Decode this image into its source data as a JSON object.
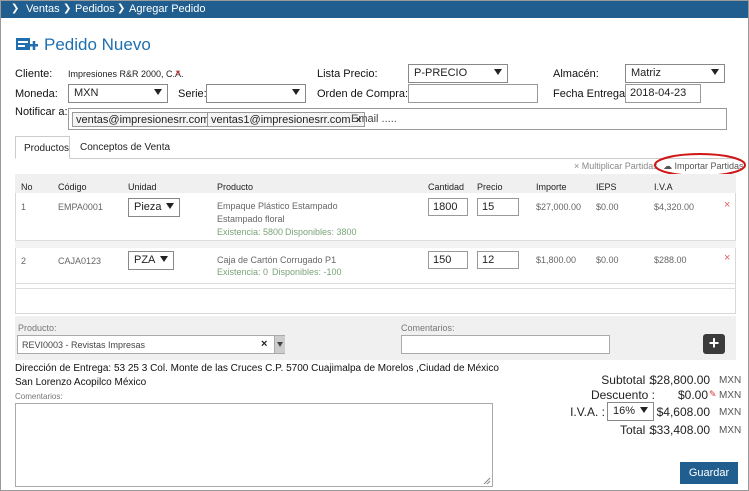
{
  "breadcrumb": [
    "Ventas",
    "Pedidos",
    "Agregar Pedido"
  ],
  "page_title": "Pedido Nuevo",
  "form": {
    "cliente_label": "Cliente:",
    "cliente_value": "Impresiones R&R 2000, C.A.",
    "cliente_clear": "×",
    "lista_precio_label": "Lista Precio:",
    "lista_precio_value": "P-PRECIO",
    "almacen_label": "Almacén:",
    "almacen_value": "Matriz",
    "moneda_label": "Moneda:",
    "moneda_value": "MXN",
    "serie_label": "Serie:",
    "serie_value": "",
    "orden_compra_label": "Orden de Compra:",
    "orden_compra_value": "",
    "fecha_entrega_label": "Fecha Entrega:",
    "fecha_entrega_value": "2018-04-23",
    "notificar_label": "Notificar a:",
    "emails": [
      "ventas@impresionesrr.com",
      "ventas1@impresionesrr.com"
    ],
    "email_placeholder": "Email ....."
  },
  "tabs": [
    "Productos",
    "Conceptos de Venta"
  ],
  "actions": {
    "multiplicar": "Multiplicar Partidas",
    "importar": "Importar Partidas"
  },
  "table": {
    "headers": [
      "No",
      "Código",
      "Unidad",
      "Producto",
      "Cantidad",
      "Precio",
      "Importe",
      "IEPS",
      "I.V.A"
    ],
    "rows": [
      {
        "no": "1",
        "codigo": "EMPA0001",
        "unidad": "Pieza",
        "producto": "Empaque Plástico Estampado",
        "producto2": "Estampado floral",
        "existencia": "Existencia: 5800",
        "disponibles": "Disponibles: 3800",
        "cantidad": "1800",
        "precio": "15",
        "importe": "$27,000.00",
        "ieps": "$0.00",
        "iva": "$4,320.00"
      },
      {
        "no": "2",
        "codigo": "CAJA0123",
        "unidad": "PZA",
        "producto": "Caja de Cartón Corrugado P1",
        "producto2": "",
        "existencia": "Existencia: 0",
        "disponibles": "Disponibles: -100",
        "cantidad": "150",
        "precio": "12",
        "importe": "$1,800.00",
        "ieps": "$0.00",
        "iva": "$288.00"
      }
    ]
  },
  "add_line": {
    "producto_label": "Producto:",
    "producto_value": "REVI0003 - Revistas Impresas",
    "comentarios_label": "Comentarios:"
  },
  "direccion": {
    "line1": "Dirección de Entrega: 53 25 3 Col. Monte de las Cruces C.P. 5700 Cuajimalpa de Morelos ,Ciudad de México",
    "line2": "San Lorenzo Acopilco México",
    "comentarios_label": "Comentarios:"
  },
  "totals": {
    "subtotal_label": "Subtotal :",
    "subtotal_value": "$28,800.00",
    "descuento_label": "Descuento :",
    "descuento_value": "$0.00",
    "iva_label": "I.V.A. :",
    "iva_rate": "16%",
    "iva_value": "$4,608.00",
    "total_label": "Total :",
    "total_value": "$33,408.00",
    "currency": "MXN"
  },
  "buttons": {
    "guardar": "Guardar"
  },
  "colors": {
    "header_bar": "#1f5e8e",
    "title": "#1f6fb0",
    "highlight_circle": "#d01515"
  }
}
